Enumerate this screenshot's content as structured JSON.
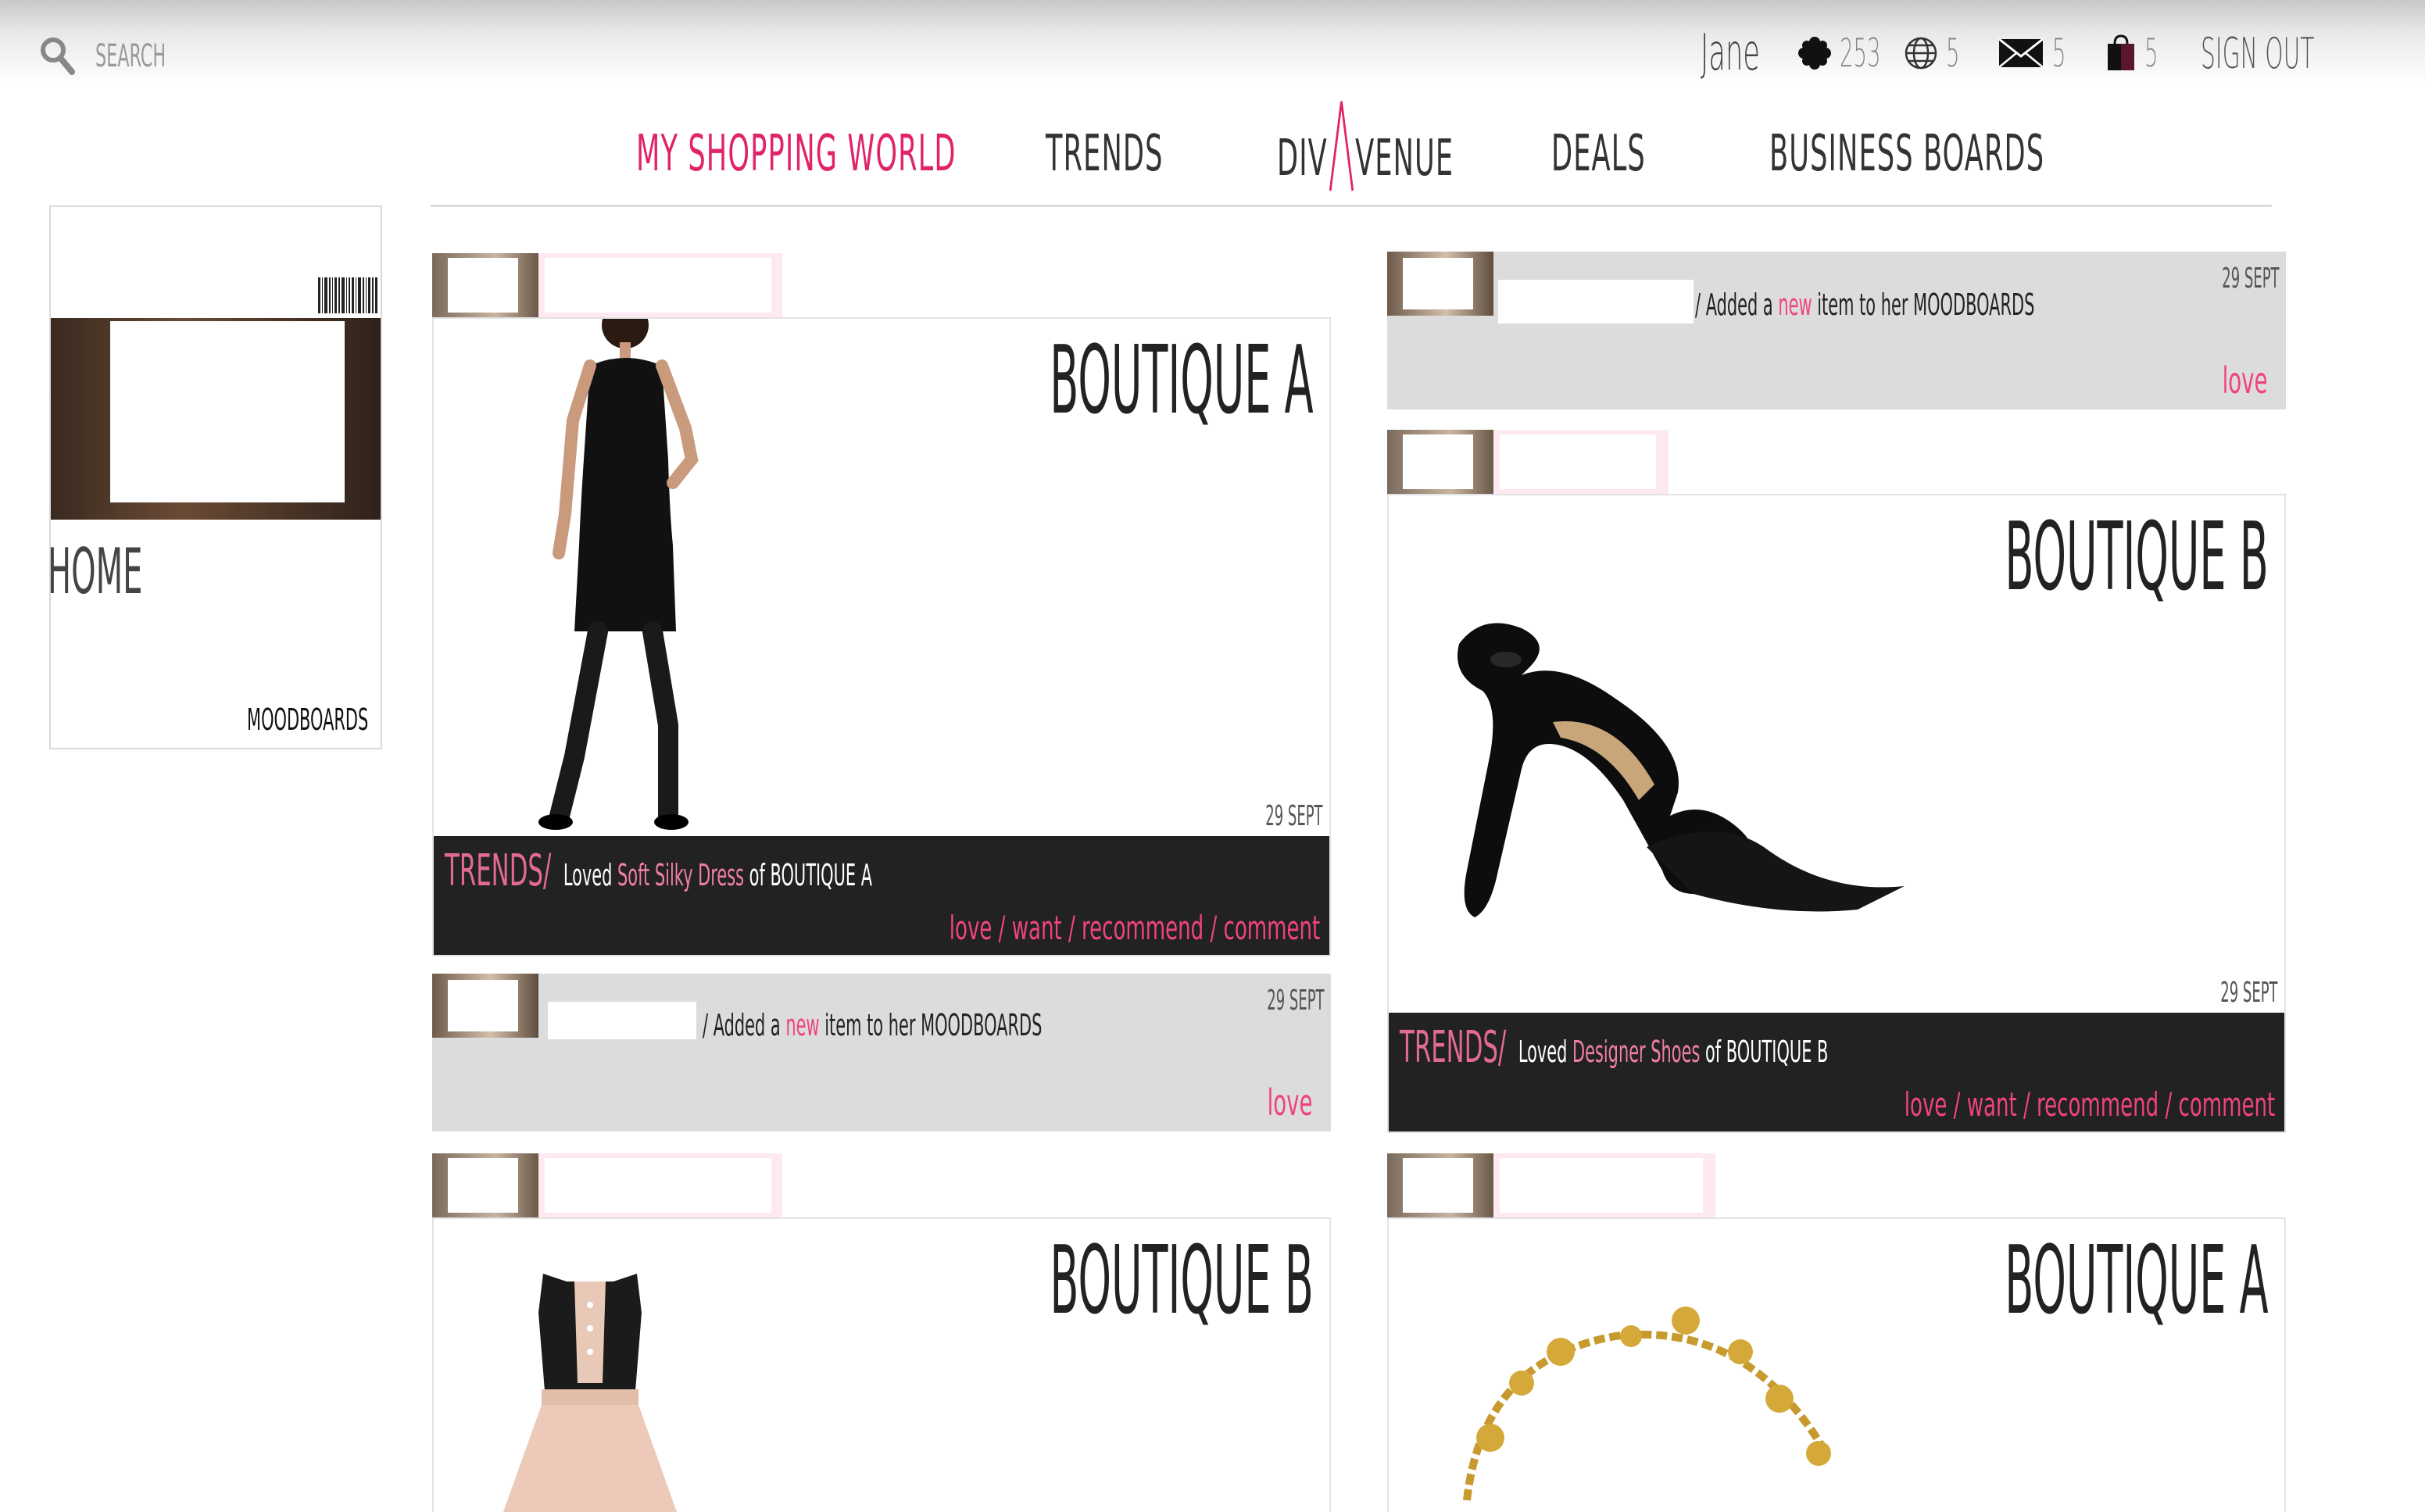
{
  "topbar": {
    "search_placeholder": "SEARCH",
    "username": "Jane",
    "points": "253",
    "globe_count": "5",
    "messages": "5",
    "cart": "5",
    "sign_out": "SIGN OUT"
  },
  "nav": {
    "items": [
      {
        "label": "MY SHOPPING WORLD",
        "active": true
      },
      {
        "label": "TRENDS"
      },
      {
        "label_a": "DIV",
        "label_b": "VENUE"
      },
      {
        "label": "DEALS"
      },
      {
        "label": "BUSINESS BOARDS"
      }
    ],
    "accent": "#e0246a"
  },
  "profile": {
    "home": "HOME",
    "moodboards": "MOODBOARDS"
  },
  "feed": {
    "left": [
      {
        "boutique": "BOUTIQUE A",
        "date": "29 SEPT",
        "trends": "TRENDS/",
        "loved": "Loved",
        "item": "Soft Silky Dress",
        "of": "of",
        "shop": "BOUTIQUE A",
        "actions": "love / want / recommend / comment"
      },
      {
        "date": "29 SEPT",
        "slash": "/",
        "added": "Added a",
        "new": "new",
        "rest": "item to her MOODBOARDS",
        "love": "love"
      },
      {
        "boutique": "BOUTIQUE B"
      }
    ],
    "right": [
      {
        "date": "29 SEPT",
        "slash": "/",
        "added": "Added a",
        "new": "new",
        "rest": "item to her MOODBOARDS",
        "love": "love"
      },
      {
        "boutique": "BOUTIQUE B",
        "date": "29 SEPT",
        "trends": "TRENDS/",
        "loved": "Loved",
        "item": "Designer Shoes",
        "of": "of",
        "shop": "BOUTIQUE B",
        "actions": "love / want / recommend / comment"
      },
      {
        "boutique": "BOUTIQUE A"
      }
    ]
  }
}
